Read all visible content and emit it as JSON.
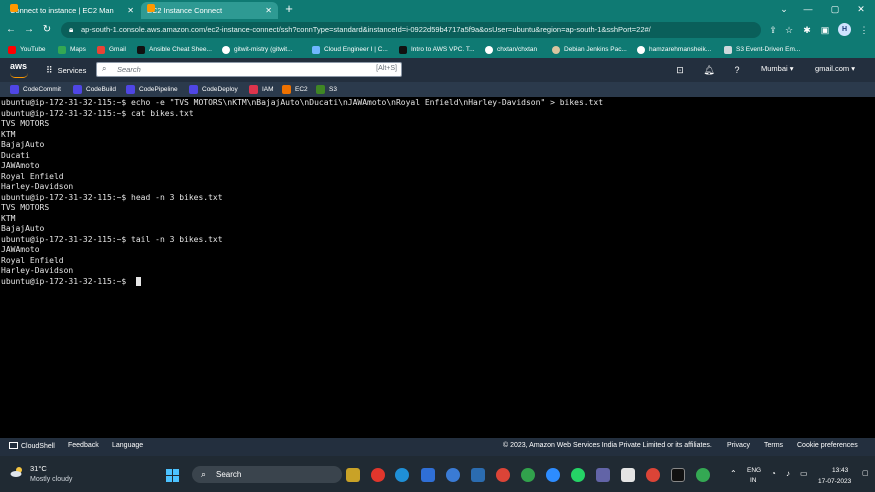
{
  "browser": {
    "tabs": [
      {
        "label": "Connect to instance | EC2 Manag",
        "active": false
      },
      {
        "label": "EC2 Instance Connect",
        "active": true
      }
    ],
    "url": "ap-south-1.console.aws.amazon.com/ec2-instance-connect/ssh?connType=standard&instanceId=i-0922d59b4717a5f9a&osUser=ubuntu&region=ap-south-1&sshPort=22#/",
    "profile_initial": "H",
    "bookmarks": [
      {
        "label": "YouTube",
        "icon": "youtube-icon"
      },
      {
        "label": "Maps",
        "icon": "maps-icon"
      },
      {
        "label": "Gmail",
        "icon": "gmail-icon"
      },
      {
        "label": "Ansible Cheat Shee...",
        "icon": "ansible-icon"
      },
      {
        "label": "gitwit-mistry (gitwit...",
        "icon": "github-icon"
      },
      {
        "label": "Cloud Engineer I | C...",
        "icon": "cloud-icon"
      },
      {
        "label": "Intro to AWS VPC. T...",
        "icon": "medium-icon"
      },
      {
        "label": "chxtan/chxtan",
        "icon": "github-icon"
      },
      {
        "label": "Debian Jenkins Pac...",
        "icon": "jenkins-icon"
      },
      {
        "label": "hamzarehmansheik...",
        "icon": "github-icon"
      },
      {
        "label": "S3 Event-Driven Em...",
        "icon": "bookmark-icon"
      }
    ]
  },
  "aws": {
    "logo_text": "aws",
    "services_label": "Services",
    "search_placeholder": "Search",
    "search_shortcut": "[Alt+S]",
    "region": "Mumbai ▾",
    "account": "gmail.com ▾",
    "favorites": [
      {
        "label": "CodeCommit",
        "color": "#4f46e5"
      },
      {
        "label": "CodeBuild",
        "color": "#4f46e5"
      },
      {
        "label": "CodePipeline",
        "color": "#4f46e5"
      },
      {
        "label": "CodeDeploy",
        "color": "#4f46e5"
      },
      {
        "label": "IAM",
        "color": "#dd344c"
      },
      {
        "label": "EC2",
        "color": "#ed7100"
      },
      {
        "label": "S3",
        "color": "#3f8624"
      }
    ]
  },
  "terminal": {
    "lines": [
      "ubuntu@ip-172-31-32-115:~$ echo -e \"TVS MOTORS\\nKTM\\nBajajAuto\\nDucati\\nJAWAmoto\\nRoyal Enfield\\nHarley-Davidson\" > bikes.txt",
      "ubuntu@ip-172-31-32-115:~$ cat bikes.txt",
      "TVS MOTORS",
      "KTM",
      "BajajAuto",
      "Ducati",
      "JAWAmoto",
      "Royal Enfield",
      "Harley-Davidson",
      "ubuntu@ip-172-31-32-115:~$ head -n 3 bikes.txt",
      "TVS MOTORS",
      "KTM",
      "BajajAuto",
      "ubuntu@ip-172-31-32-115:~$ tail -n 3 bikes.txt",
      "JAWAmoto",
      "Royal Enfield",
      "Harley-Davidson",
      "ubuntu@ip-172-31-32-115:~$ "
    ]
  },
  "footer": {
    "cloudshell": "CloudShell",
    "feedback": "Feedback",
    "language": "Language",
    "copyright": "© 2023, Amazon Web Services India Private Limited or its affiliates.",
    "privacy": "Privacy",
    "terms": "Terms",
    "cookies": "Cookie preferences"
  },
  "taskbar": {
    "temperature": "31°C",
    "weather": "Mostly cloudy",
    "search_label": "Search",
    "lang_line1": "ENG",
    "lang_line2": "IN",
    "time": "13:43",
    "date": "17-07-2023"
  },
  "colors": {
    "chrome_frame": "#0f7a73",
    "aws_nav": "#232f3e",
    "aws_orange": "#ff9900",
    "terminal_bg": "#000000",
    "terminal_fg": "#e6e6e6"
  }
}
